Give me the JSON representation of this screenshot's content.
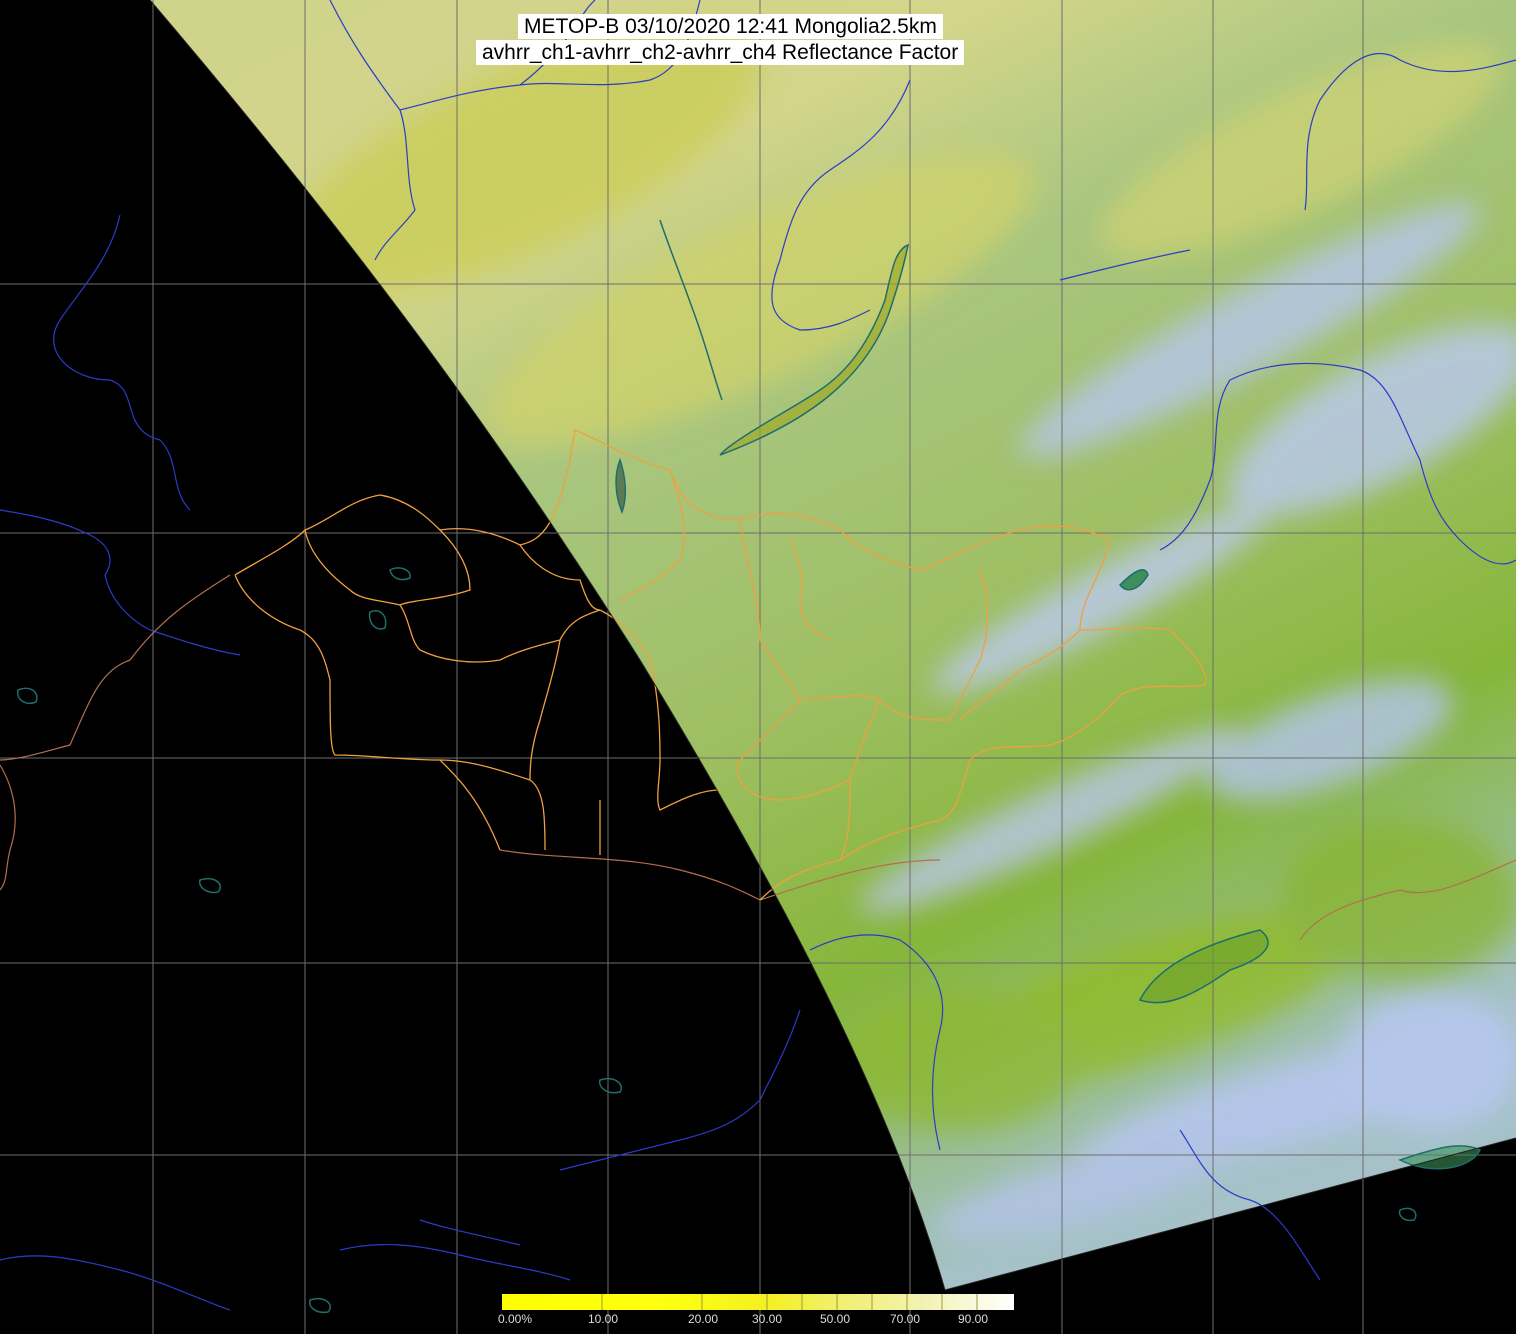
{
  "title": {
    "line1": "METOP-B 03/10/2020 12:41 Mongolia2.5km",
    "line2": "avhrr_ch1-avhrr_ch2-avhrr_ch4 Reflectance Factor"
  },
  "colorbar": {
    "labels": [
      "0.00%",
      "10.00",
      "20.00",
      "30.00",
      "50.00",
      "70.00",
      "90.00"
    ],
    "stops": [
      "#ffff00",
      "#ffff10",
      "#f4f020",
      "#f0f070",
      "#f2f2b0",
      "#ffffff"
    ]
  },
  "colors": {
    "background": "#000000",
    "grid": "#6e6e6e",
    "swath_north": "#cfd38a",
    "swath_mid": "#9fbf64",
    "swath_south": "#86b63a",
    "cloud": "#b9c8f0",
    "rivers": "#2a3cc8",
    "lakes": "#1e6e6e",
    "province_borders": "#f0a040",
    "country_borders": "#b07050"
  }
}
